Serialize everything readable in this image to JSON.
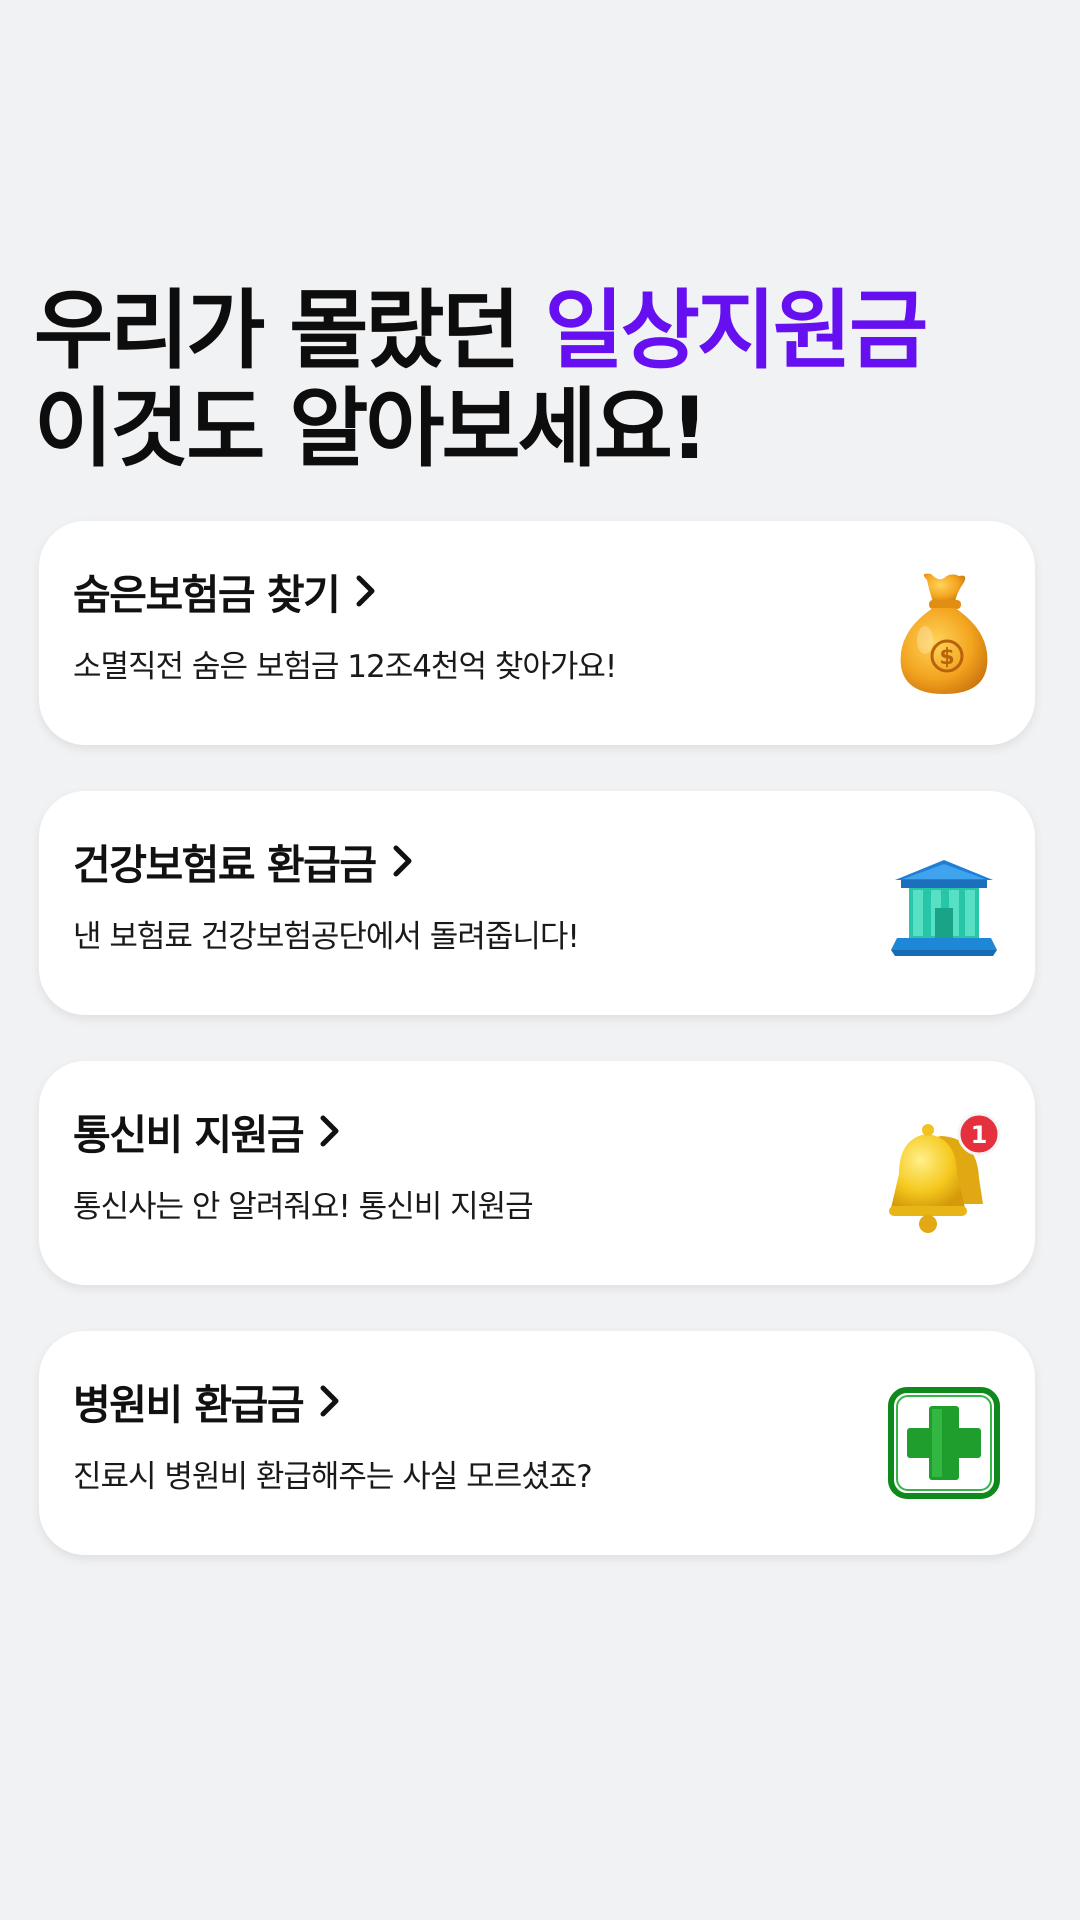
{
  "headline": {
    "line1_main": "우리가 몰랐던 ",
    "line1_accent": "일상지원금",
    "line2": "이것도 알아보세요!"
  },
  "accent_color": "#6610f2",
  "cards": [
    {
      "title": "숨은보험금 찾기",
      "subtitle": "소멸직전 숨은 보험금 12조4천억 찾아가요!",
      "icon": "money-bag-icon"
    },
    {
      "title": "건강보험료 환급금",
      "subtitle": "낸 보험료 건강보험공단에서 돌려줍니다!",
      "icon": "bank-building-icon"
    },
    {
      "title": "통신비 지원금",
      "subtitle": "통신사는 안 알려줘요! 통신비 지원금",
      "icon": "notification-bell-icon",
      "badge": "1"
    },
    {
      "title": "병원비 환급금",
      "subtitle": "진료시 병원비 환급해주는 사실 모르셨죠?",
      "icon": "medical-cross-icon"
    }
  ]
}
